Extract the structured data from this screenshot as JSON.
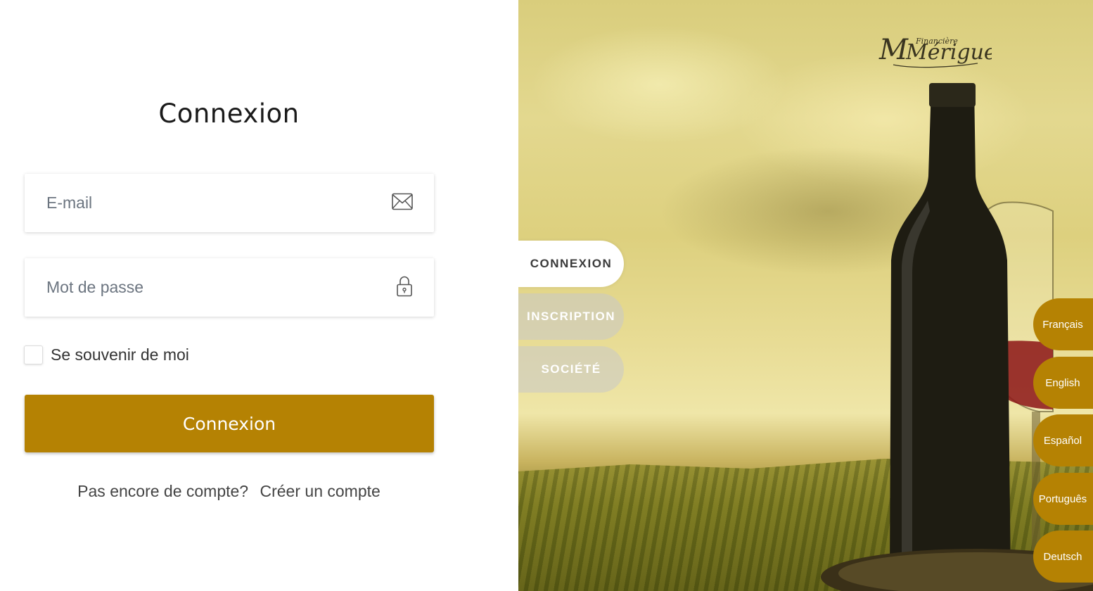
{
  "login": {
    "title": "Connexion",
    "email_placeholder": "E-mail",
    "password_placeholder": "Mot de passe",
    "remember_label": "Se souvenir de moi",
    "submit_label": "Connexion",
    "no_account_text": "Pas encore de compte?",
    "create_account_link": "Créer un compte",
    "email_icon": "envelope-icon",
    "password_icon": "lock-icon"
  },
  "brand": {
    "logo_script": "Mériguet",
    "logo_small": "Financière"
  },
  "side_tabs": [
    {
      "label": "CONNEXION",
      "active": true
    },
    {
      "label": "INSCRIPTION",
      "active": false
    },
    {
      "label": "SOCIÉTÉ",
      "active": false
    }
  ],
  "languages": [
    "Français",
    "English",
    "Español",
    "Português",
    "Deutsch"
  ],
  "colors": {
    "accent": "#b58203",
    "background": "#ffffff"
  }
}
